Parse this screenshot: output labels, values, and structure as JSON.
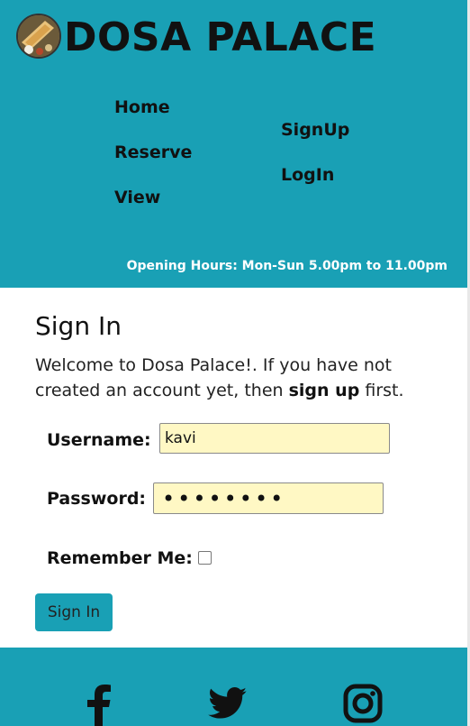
{
  "header": {
    "brand": "DOSA PALACE",
    "nav": {
      "home": "Home",
      "reserve": "Reserve",
      "view": "View",
      "signup": "SignUp",
      "login": "LogIn"
    },
    "hours": "Opening Hours: Mon-Sun 5.00pm to 11.00pm"
  },
  "form": {
    "title": "Sign In",
    "welcome_prefix": "Welcome to Dosa Palace!. If you have not created an account yet, then ",
    "welcome_bold": "sign up",
    "welcome_suffix": " first.",
    "username_label": "Username:",
    "username_value": "kavi",
    "password_label": "Password:",
    "password_masked": "••••••••",
    "remember_label": "Remember Me:",
    "remember_checked": false,
    "submit_label": "Sign In"
  },
  "footer": {
    "icons": [
      "facebook-icon",
      "twitter-icon",
      "instagram-icon"
    ]
  },
  "colors": {
    "header_bg": "#19a0b5",
    "input_bg": "#fff8c4",
    "hours_text": "#ffffff"
  }
}
